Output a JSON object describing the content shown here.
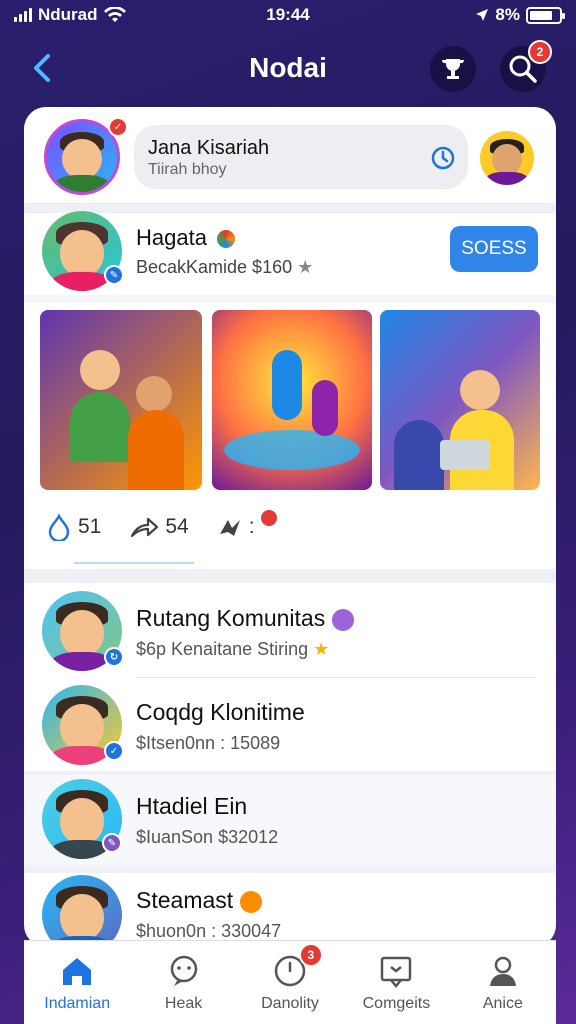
{
  "status": {
    "carrier": "Ndurad",
    "time": "19:44",
    "battery": "8%",
    "battery_level": 0.8
  },
  "header": {
    "title": "Nodai",
    "search_badge": "2"
  },
  "profile_search": {
    "title": "Jana Kisariah",
    "subtitle": "Tiirah bhoy"
  },
  "post": {
    "author": "Hagata",
    "meta": "BecakKamide $160",
    "follow_label": "SOESS",
    "likes": "51",
    "shares": "54",
    "more": ":"
  },
  "communities": [
    {
      "name": "Rutang Komunitas",
      "subtitle": "$6p Kenaitane Stiring"
    },
    {
      "name": "Coqdg Klonitime",
      "subtitle": "$Itsen0nn : 15089"
    },
    {
      "name": "Htadiel Ein",
      "subtitle": "$IuanSon $32012"
    },
    {
      "name": "Steamast",
      "subtitle": "$huon0n : 330047"
    }
  ],
  "tabs": [
    {
      "label": "Indamian",
      "active": true
    },
    {
      "label": "Heak",
      "active": false
    },
    {
      "label": "Danolity",
      "active": false,
      "badge": "3"
    },
    {
      "label": "Comgeits",
      "active": false
    },
    {
      "label": "Anice",
      "active": false
    }
  ],
  "colors": {
    "accent": "#2f86e8",
    "badge": "#e53935",
    "background": "#2a1f6e",
    "active_tab": "#1e73e0"
  },
  "icons": [
    "back-icon",
    "trophy-icon",
    "search-icon",
    "clock-icon",
    "home-icon",
    "chat-icon",
    "notification-icon",
    "message-icon",
    "profile-icon"
  ]
}
